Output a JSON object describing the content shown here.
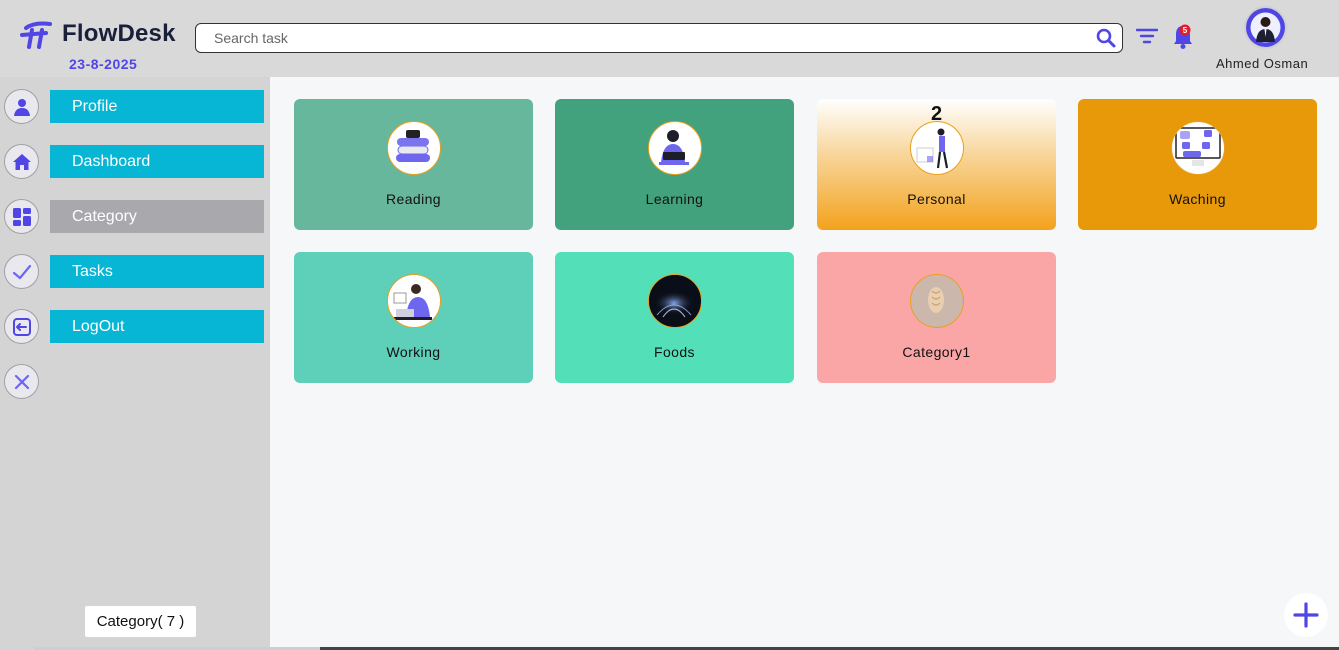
{
  "header": {
    "app_name": "FlowDesk",
    "date": "23-8-2025",
    "search_placeholder": "Search task",
    "notification_count": "5",
    "user_name": "Ahmed Osman"
  },
  "sidebar": {
    "items": [
      {
        "label": "Profile",
        "icon": "user-icon"
      },
      {
        "label": "Dashboard",
        "icon": "home-icon"
      },
      {
        "label": "Category",
        "icon": "grid-icon",
        "active": true
      },
      {
        "label": "Tasks",
        "icon": "check-icon"
      },
      {
        "label": "LogOut",
        "icon": "logout-icon"
      }
    ],
    "close_icon": "close-icon",
    "category_count_label": "Category( 7 )"
  },
  "categories": [
    {
      "label": "Reading",
      "color": "#66b79c"
    },
    {
      "label": "Learning",
      "color": "#42a27d"
    },
    {
      "label": "Personal",
      "color": "#f3a21c",
      "badge": "2"
    },
    {
      "label": "Waching",
      "color": "#e8990a"
    },
    {
      "label": "Working",
      "color": "#5ecfb8"
    },
    {
      "label": "Foods",
      "color": "#53e0b8"
    },
    {
      "label": "Category1",
      "color": "#fba6a6"
    }
  ],
  "colors": {
    "accent": "#4f46e5",
    "sidebar_button": "#06b6d4",
    "sidebar_active": "#a8a8ad"
  }
}
